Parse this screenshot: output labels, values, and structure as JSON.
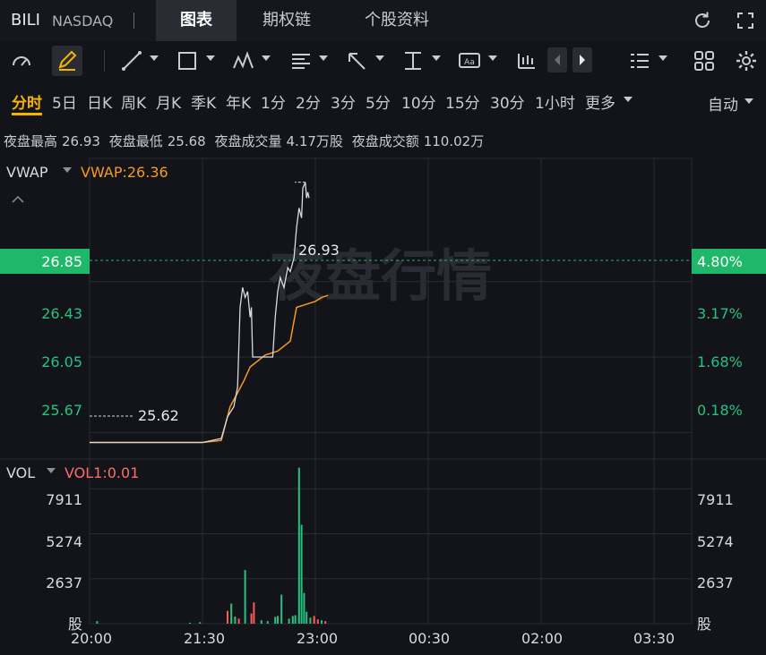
{
  "header": {
    "symbol": "BILI",
    "exchange": "NASDAQ",
    "tabs": [
      "图表",
      "期权链",
      "个股资料"
    ],
    "active_tab": "图表"
  },
  "periods": {
    "items": [
      "分时",
      "5日",
      "日K",
      "周K",
      "月K",
      "季K",
      "年K",
      "1分",
      "2分",
      "3分",
      "5分",
      "10分",
      "15分",
      "30分",
      "1小时",
      "更多"
    ],
    "active": "分时",
    "auto_label": "自动"
  },
  "stats": {
    "high_label": "夜盘最高",
    "high_value": "26.93",
    "low_label": "夜盘最低",
    "low_value": "25.68",
    "volume_label": "夜盘成交量",
    "volume_value": "4.17万股",
    "amount_label": "夜盘成交额",
    "amount_value": "110.02万"
  },
  "price_panel": {
    "indicator": "VWAP",
    "indicator_value": "VWAP:26.36",
    "watermark": "夜盘行情",
    "current_price": "26.85",
    "current_pct": "4.80%",
    "left_ticks": [
      "26.43",
      "26.05",
      "25.67"
    ],
    "right_ticks": [
      "3.17%",
      "1.68%",
      "0.18%"
    ],
    "max_marker": "26.93",
    "min_marker": "25.62"
  },
  "volume_panel": {
    "indicator": "VOL",
    "indicator_value": "VOL1:0.01",
    "ticks": [
      "7911",
      "5274",
      "2637"
    ],
    "unit": "股"
  },
  "time_axis": [
    "20:00",
    "21:30",
    "23:00",
    "00:30",
    "02:00",
    "03:30"
  ],
  "colors": {
    "up": "#26c281",
    "down": "#ff5a5a",
    "vwap": "#f59a23",
    "price_line": "#d9dadf",
    "accent": "#f4b400",
    "current_bg": "#1fb86a"
  },
  "chart_data": {
    "type": "line",
    "x_range": [
      "20:00",
      "04:00"
    ],
    "price": {
      "ylim": [
        25.55,
        27.05
      ],
      "series": [
        {
          "name": "VWAP",
          "points": [
            [
              0,
              25.62
            ],
            [
              60,
              25.62
            ],
            [
              90,
              25.62
            ],
            [
              105,
              25.63
            ],
            [
              112,
              25.8
            ],
            [
              118,
              25.87
            ],
            [
              123,
              25.93
            ],
            [
              128,
              26.0
            ],
            [
              140,
              26.06
            ],
            [
              150,
              26.08
            ],
            [
              160,
              26.13
            ],
            [
              165,
              26.3
            ],
            [
              170,
              26.31
            ],
            [
              180,
              26.33
            ],
            [
              185,
              26.35
            ],
            [
              190,
              26.36
            ]
          ]
        },
        {
          "name": "",
          "points": [
            [
              0,
              25.62
            ],
            [
              60,
              25.62
            ],
            [
              90,
              25.62
            ],
            [
              105,
              25.64
            ],
            [
              110,
              25.75
            ],
            [
              115,
              25.8
            ],
            [
              118,
              25.9
            ],
            [
              120,
              26.3
            ],
            [
              122,
              26.4
            ],
            [
              124,
              26.35
            ],
            [
              126,
              26.38
            ],
            [
              128,
              26.25
            ],
            [
              129,
              26.3
            ],
            [
              130,
              26.05
            ],
            [
              132,
              26.05
            ],
            [
              140,
              26.05
            ],
            [
              146,
              26.05
            ],
            [
              148,
              26.25
            ],
            [
              150,
              26.38
            ],
            [
              152,
              26.45
            ],
            [
              155,
              26.4
            ],
            [
              158,
              26.5
            ],
            [
              160,
              26.48
            ],
            [
              163,
              26.55
            ],
            [
              165,
              26.7
            ],
            [
              167,
              26.8
            ],
            [
              169,
              26.75
            ],
            [
              170,
              26.9
            ],
            [
              172,
              26.93
            ],
            [
              173,
              26.85
            ],
            [
              174,
              26.88
            ],
            [
              175,
              26.85
            ]
          ]
        }
      ]
    },
    "volume": {
      "ylim": [
        0,
        9500
      ],
      "bars": [
        [
          6,
          150,
          "up"
        ],
        [
          80,
          60,
          "up"
        ],
        [
          88,
          90,
          "up"
        ],
        [
          110,
          750,
          "down"
        ],
        [
          113,
          1180,
          "up"
        ],
        [
          116,
          420,
          "up"
        ],
        [
          119,
          300,
          "down"
        ],
        [
          124,
          3150,
          "up"
        ],
        [
          129,
          600,
          "down"
        ],
        [
          131,
          1250,
          "down"
        ],
        [
          137,
          200,
          "up"
        ],
        [
          142,
          150,
          "up"
        ],
        [
          148,
          400,
          "up"
        ],
        [
          150,
          450,
          "up"
        ],
        [
          153,
          1700,
          "up"
        ],
        [
          159,
          300,
          "up"
        ],
        [
          162,
          450,
          "up"
        ],
        [
          164,
          500,
          "up"
        ],
        [
          167,
          9150,
          "up"
        ],
        [
          169,
          5800,
          "up"
        ],
        [
          171,
          1800,
          "up"
        ],
        [
          173,
          700,
          "up"
        ],
        [
          176,
          350,
          "up"
        ],
        [
          179,
          450,
          "down"
        ],
        [
          182,
          250,
          "down"
        ],
        [
          185,
          200,
          "up"
        ],
        [
          188,
          150,
          "down"
        ]
      ]
    }
  }
}
